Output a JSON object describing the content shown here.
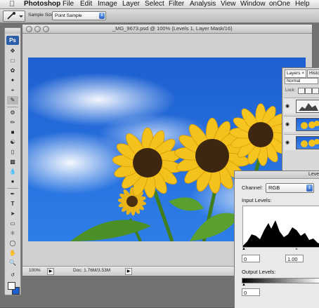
{
  "menubar": {
    "apple_icon": "apple-logo",
    "app": "Photoshop",
    "items": [
      "File",
      "Edit",
      "Image",
      "Layer",
      "Select",
      "Filter",
      "Analysis",
      "View",
      "Window",
      "onOne",
      "Help"
    ]
  },
  "options_bar": {
    "tool_icon": "eyedropper-icon",
    "sample_size_label": "Sample Size:",
    "sample_size_value": "Point Sample"
  },
  "document": {
    "title": "_MG_9673.psd @ 100% (Levels 1, Layer Mask/16)",
    "zoom": "100%",
    "doc_size": "Doc: 1.76M/3.53M"
  },
  "layers_panel": {
    "tabs": [
      "Layers",
      "Histo"
    ],
    "blend_mode": "Normal",
    "lock_label": "Lock:",
    "layers": [
      {
        "type": "adjustment",
        "visible": true
      },
      {
        "type": "image",
        "visible": true
      },
      {
        "type": "image",
        "visible": true
      }
    ]
  },
  "levels_dialog": {
    "title": "Leve",
    "channel_label": "Channel:",
    "channel_value": "RGB",
    "input_levels_label": "Input Levels:",
    "input_black": "0",
    "input_gamma": "1.00",
    "output_levels_label": "Output Levels:",
    "output_black": "0"
  },
  "colors": {
    "sky": "#1c5fcd",
    "petal": "#f4c21c",
    "accent": "#2a5ea8"
  }
}
